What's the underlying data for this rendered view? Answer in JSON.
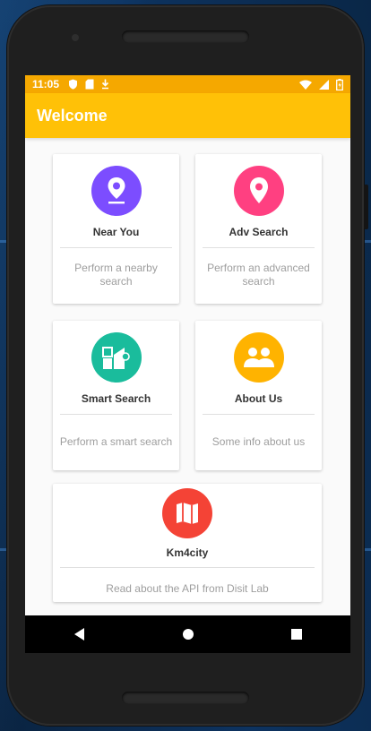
{
  "statusbar": {
    "time": "11:05"
  },
  "appbar": {
    "title": "Welcome"
  },
  "colors": {
    "statusbar": "#f5a800",
    "appbar": "#ffc107",
    "near_you": "#7c4dff",
    "adv_search": "#ff4081",
    "smart_search": "#1abc9c",
    "about_us": "#ffb300",
    "km4city": "#f44336"
  },
  "cards": [
    {
      "title": "Near You",
      "description": "Perform a nearby search",
      "icon": "location-pin-icon"
    },
    {
      "title": "Adv Search",
      "description": "Perform an advanced search",
      "icon": "location-pin-icon"
    },
    {
      "title": "Smart Search",
      "description": "Perform a smart search",
      "icon": "smart-search-icon"
    },
    {
      "title": "About Us",
      "description": "Some info about us",
      "icon": "group-icon"
    },
    {
      "title": "Km4city",
      "description": "Read about the API from Disit Lab",
      "icon": "map-icon"
    }
  ],
  "navbar": {
    "icons": [
      "back-icon",
      "home-icon",
      "recents-icon"
    ]
  }
}
